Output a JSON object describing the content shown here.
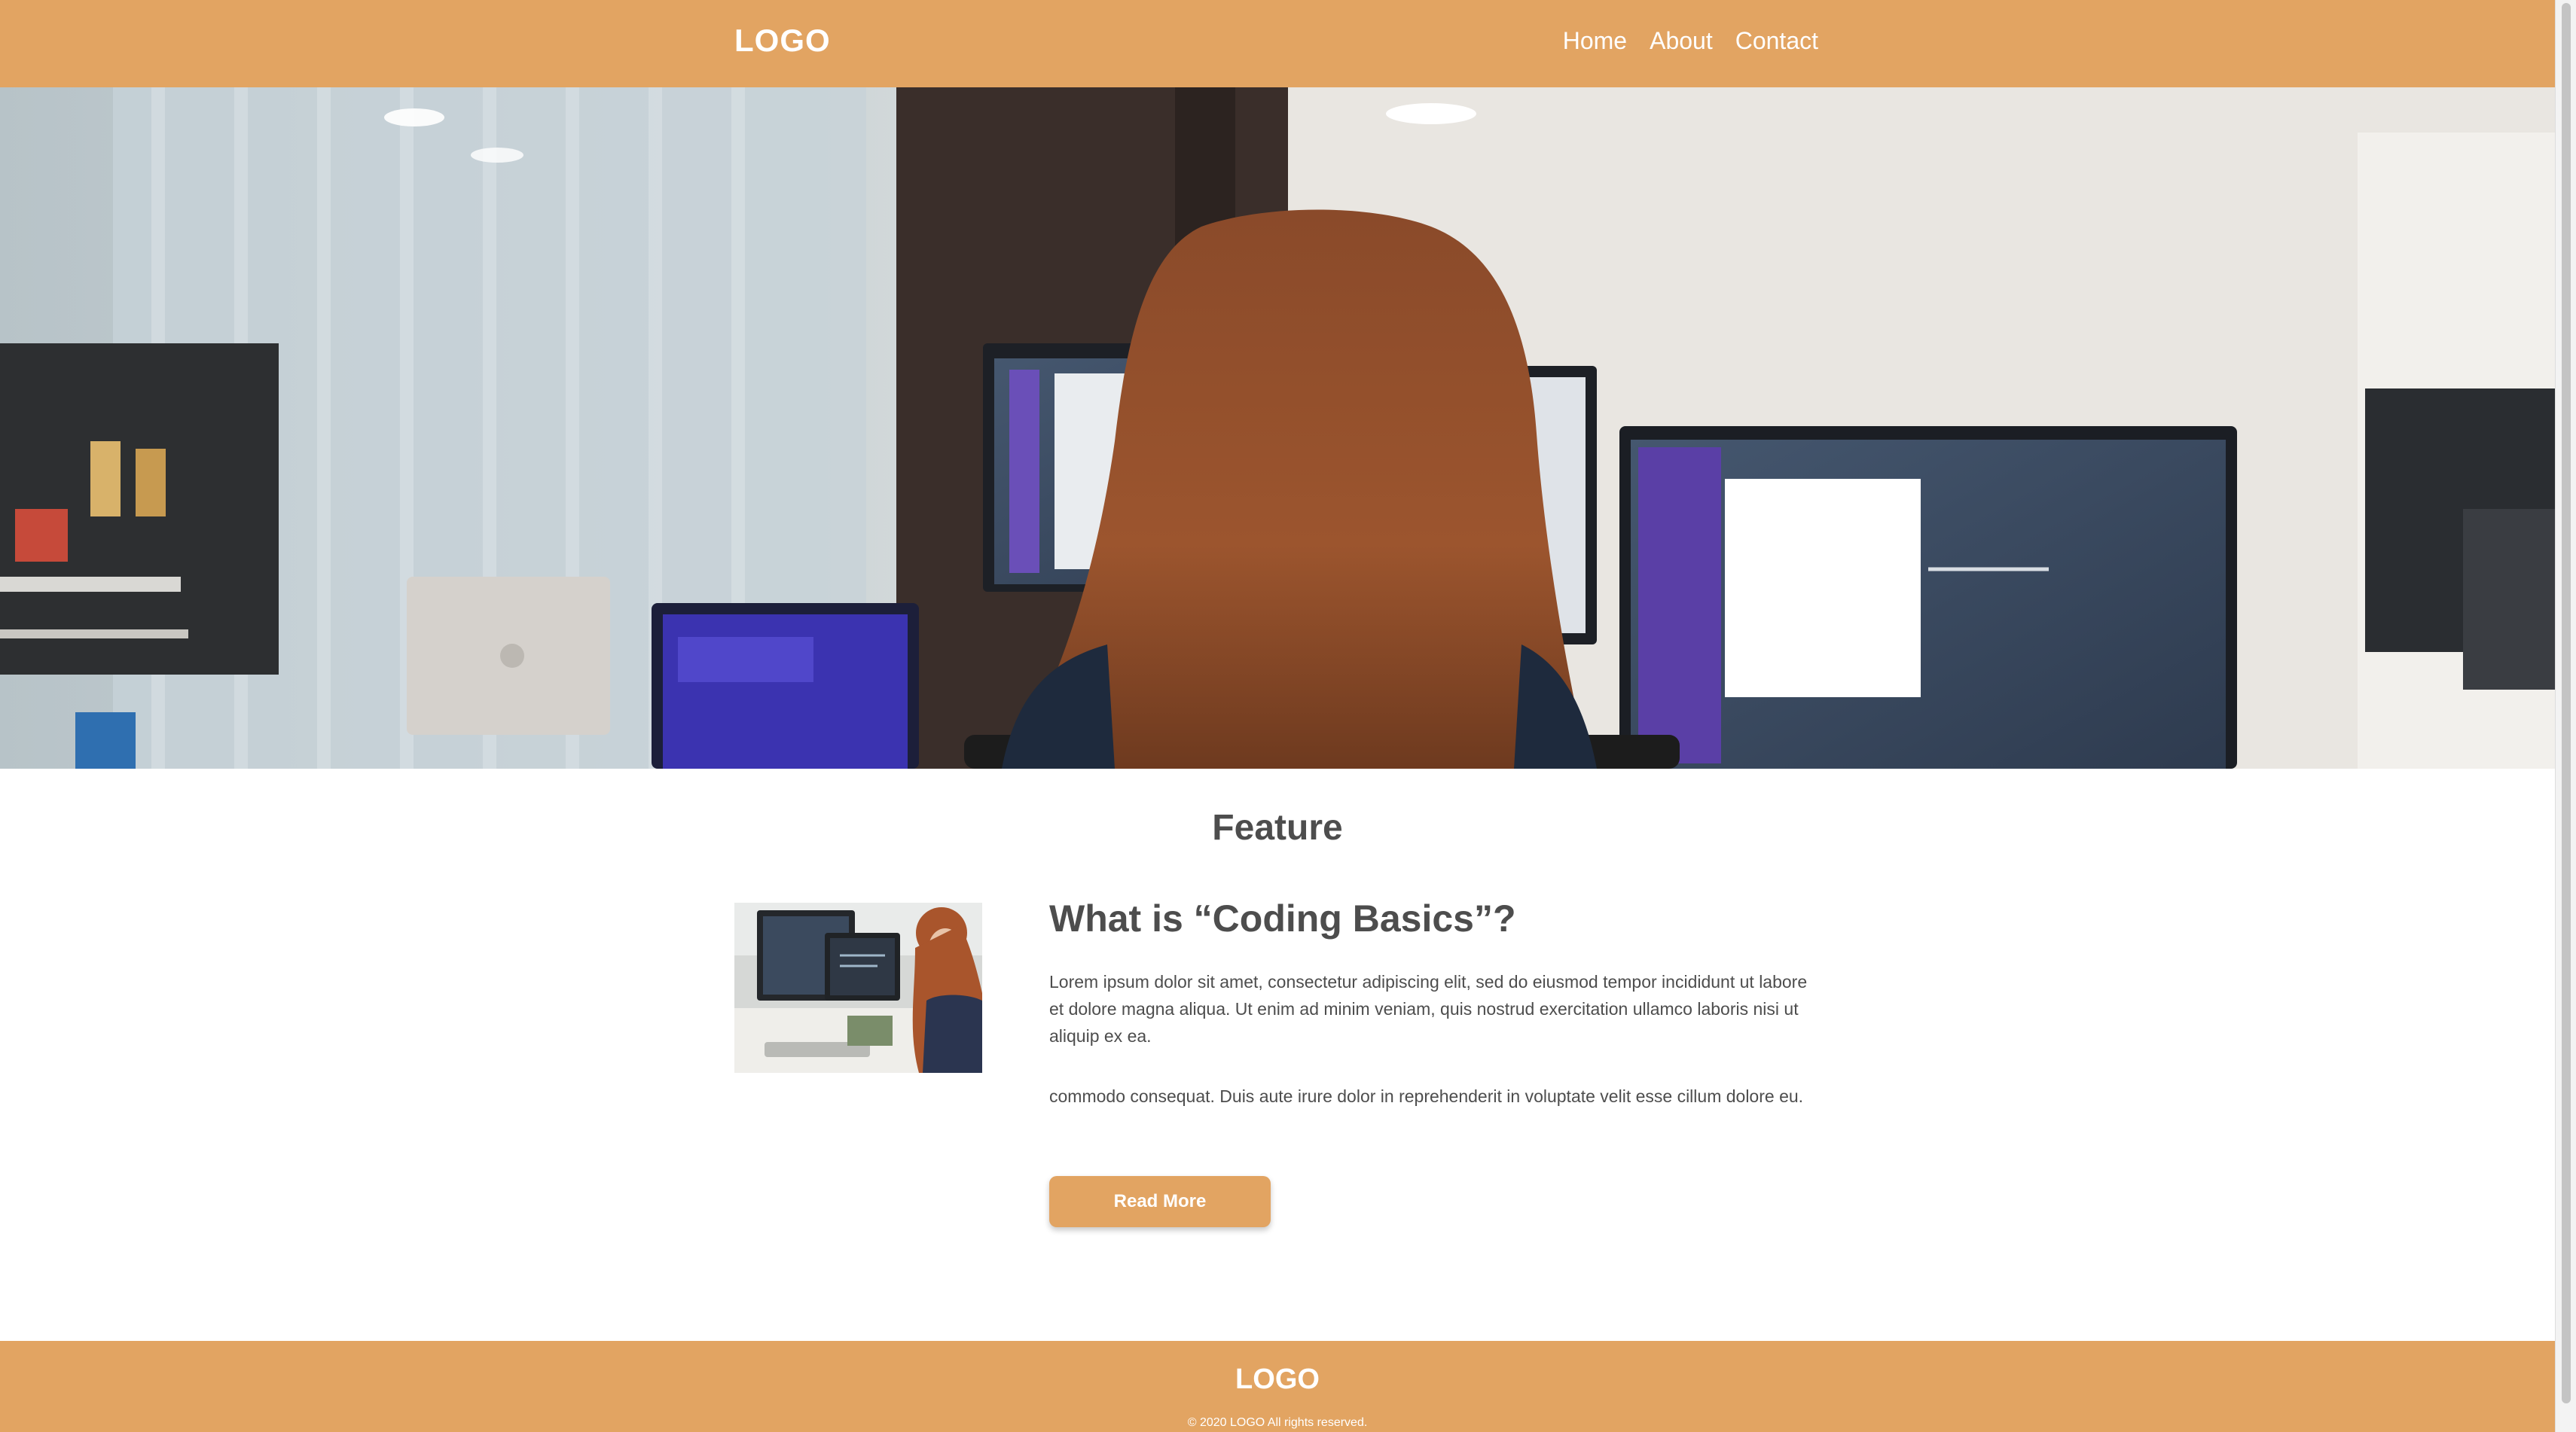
{
  "header": {
    "logo": "LOGO",
    "nav": [
      "Home",
      "About",
      "Contact"
    ]
  },
  "hero": {
    "image": "photo-woman-at-desk-with-monitors"
  },
  "feature": {
    "section_title": "Feature",
    "thumbnail": "photo-woman-coding",
    "article_title": "What is “Coding Basics”?",
    "paragraph_1": "Lorem ipsum dolor sit amet, consectetur adipiscing elit, sed do eiusmod tempor incididunt ut labore et dolore magna aliqua. Ut enim ad minim veniam, quis nostrud exercitation ullamco laboris nisi ut aliquip ex ea.",
    "paragraph_2": "commodo consequat. Duis aute irure dolor in reprehenderit in voluptate velit esse cillum dolore eu.",
    "button_label": "Read More"
  },
  "footer": {
    "logo": "LOGO",
    "copyright": "© 2020 LOGO All rights reserved."
  },
  "colors": {
    "accent": "#e2a462",
    "text": "#4d4d4d",
    "background": "#ffffff"
  }
}
